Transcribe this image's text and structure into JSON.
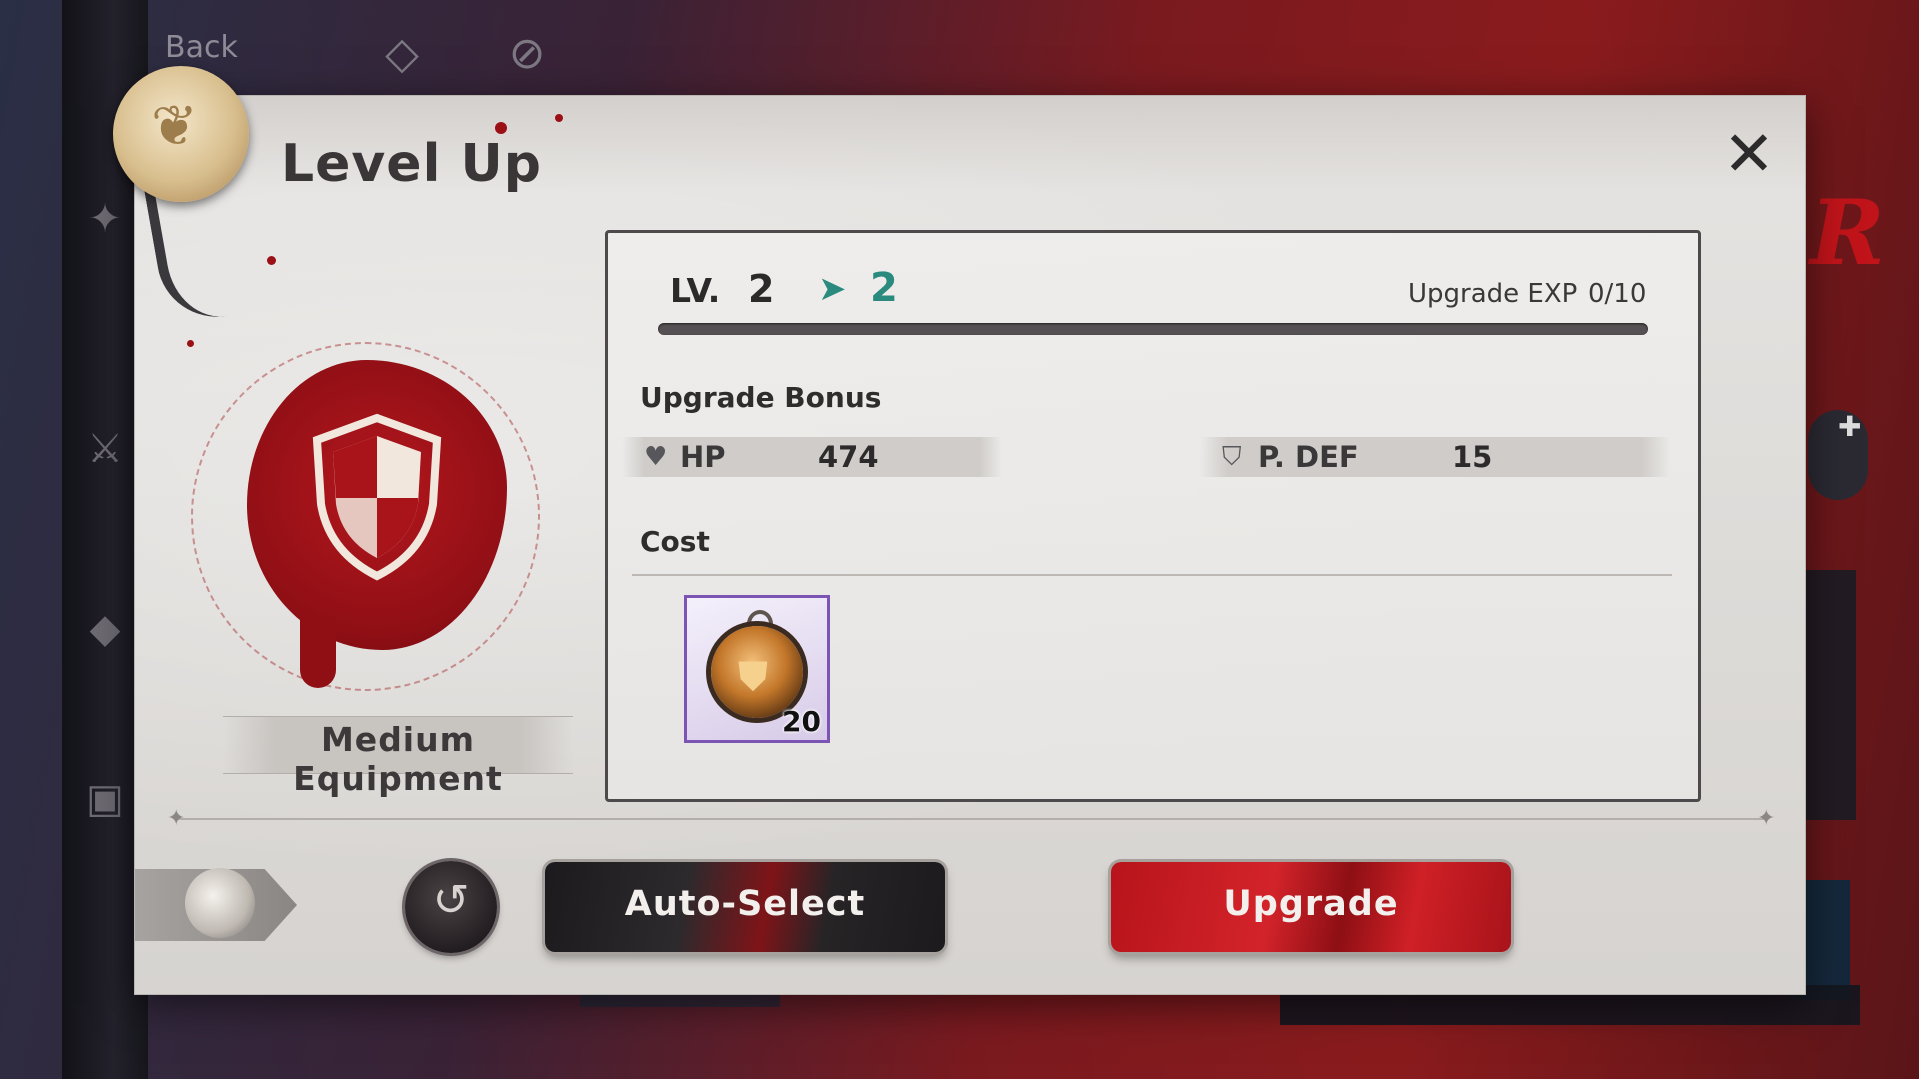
{
  "background": {
    "back_label": "Back",
    "top_icons": [
      "diamond-icon",
      "alert-icon"
    ],
    "rail_icons": [
      "crest-icon",
      "sword-shield-icon",
      "gem-icon",
      "camera-icon"
    ]
  },
  "dialog": {
    "title": "Level Up",
    "close_icon": "close-icon"
  },
  "equipment": {
    "type_label": "Medium Equipment",
    "emblem_icon": "shield-icon"
  },
  "level": {
    "label": "LV.",
    "current": "2",
    "next": "2",
    "exp_label": "Upgrade EXP",
    "exp_value": "0/10",
    "exp_fraction": 0
  },
  "bonus": {
    "title": "Upgrade Bonus",
    "stats": [
      {
        "icon": "heart-icon",
        "name": "HP",
        "value": "474"
      },
      {
        "icon": "shield-icon",
        "name": "P. DEF",
        "value": "15"
      }
    ]
  },
  "cost": {
    "title": "Cost",
    "items": [
      {
        "icon": "medal-icon",
        "quantity": "20"
      }
    ]
  },
  "buttons": {
    "reset_icon": "reset-icon",
    "auto_select": "Auto-Select",
    "upgrade": "Upgrade"
  },
  "colors": {
    "accent_teal": "#2b8a7e",
    "upgrade_red": "#c8191f",
    "item_frame_purple": "#7b54b4"
  }
}
